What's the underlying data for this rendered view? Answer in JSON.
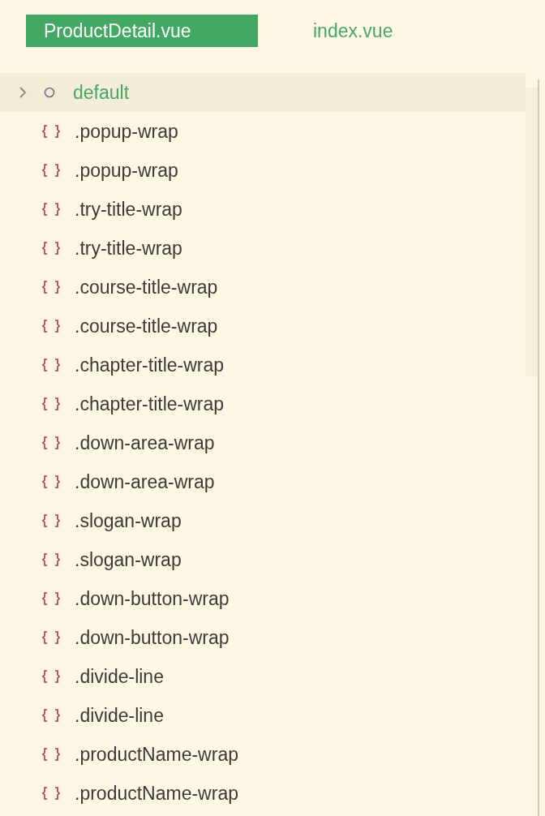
{
  "tabs": [
    {
      "label": "ProductDetail.vue",
      "selected": true
    },
    {
      "label": "index.vue",
      "selected": false
    }
  ],
  "outline": [
    {
      "kind": "module",
      "label": "default",
      "expanded": false,
      "selected": true
    },
    {
      "kind": "selector",
      "label": ".popup-wrap",
      "selected": false
    },
    {
      "kind": "selector",
      "label": ".popup-wrap",
      "selected": false
    },
    {
      "kind": "selector",
      "label": ".try-title-wrap",
      "selected": false
    },
    {
      "kind": "selector",
      "label": ".try-title-wrap",
      "selected": false
    },
    {
      "kind": "selector",
      "label": ".course-title-wrap",
      "selected": false
    },
    {
      "kind": "selector",
      "label": ".course-title-wrap",
      "selected": false
    },
    {
      "kind": "selector",
      "label": ".chapter-title-wrap",
      "selected": false
    },
    {
      "kind": "selector",
      "label": ".chapter-title-wrap",
      "selected": false
    },
    {
      "kind": "selector",
      "label": ".down-area-wrap",
      "selected": false
    },
    {
      "kind": "selector",
      "label": ".down-area-wrap",
      "selected": false
    },
    {
      "kind": "selector",
      "label": ".slogan-wrap",
      "selected": false
    },
    {
      "kind": "selector",
      "label": ".slogan-wrap",
      "selected": false
    },
    {
      "kind": "selector",
      "label": ".down-button-wrap",
      "selected": false
    },
    {
      "kind": "selector",
      "label": ".down-button-wrap",
      "selected": false
    },
    {
      "kind": "selector",
      "label": ".divide-line",
      "selected": false
    },
    {
      "kind": "selector",
      "label": ".divide-line",
      "selected": false
    },
    {
      "kind": "selector",
      "label": ".productName-wrap",
      "selected": false
    },
    {
      "kind": "selector",
      "label": ".productName-wrap",
      "selected": false
    }
  ]
}
